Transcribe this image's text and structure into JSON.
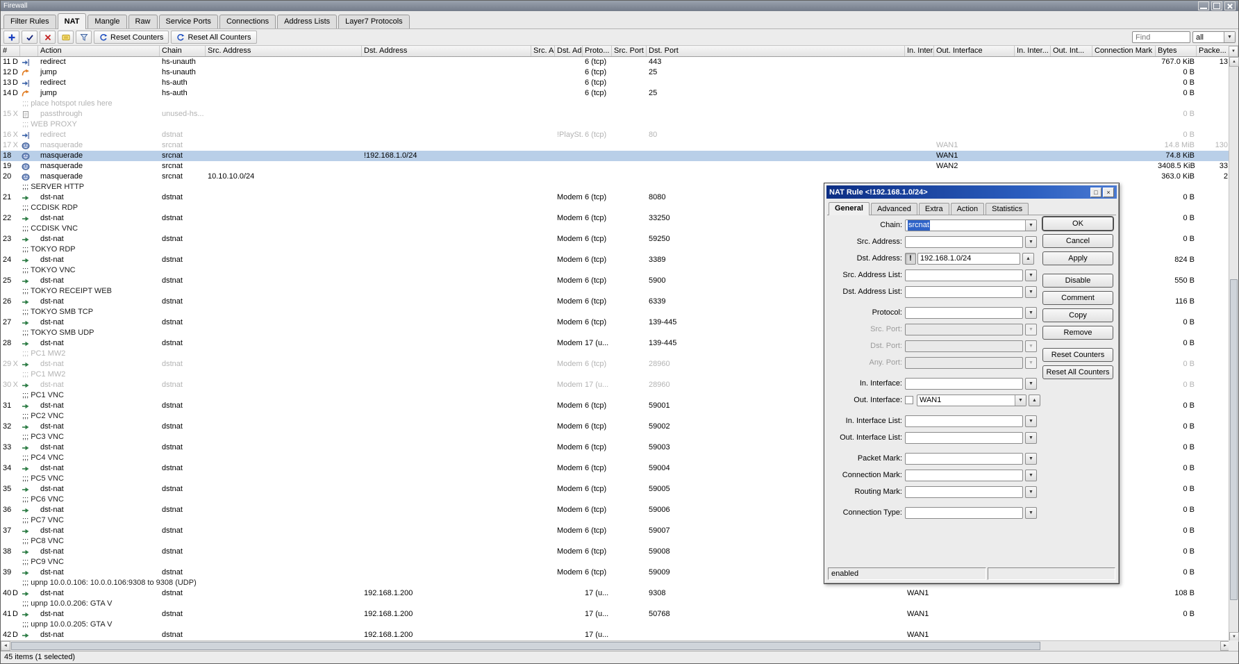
{
  "window": {
    "title": "Firewall"
  },
  "tabs": [
    "Filter Rules",
    "NAT",
    "Mangle",
    "Raw",
    "Service Ports",
    "Connections",
    "Address Lists",
    "Layer7 Protocols"
  ],
  "active_tab": "NAT",
  "toolbar": {
    "reset_counters_label": "Reset Counters",
    "reset_all_counters_label": "Reset All Counters",
    "find_placeholder": "Find",
    "filter_scope": "all"
  },
  "icons": {
    "up": "▲",
    "down": "▼",
    "left": "◄",
    "right": "►",
    "maximize": "□",
    "close": "×",
    "negate": "!"
  },
  "colors": {
    "dialog_titlebar": "#0c2e84",
    "selected_row": "#b9cfe8",
    "disabled_text": "#b3b3b3",
    "accent_blue": "#2f63c8"
  },
  "table": {
    "columns": [
      {
        "key": "num",
        "label": "#"
      },
      {
        "key": "icon",
        "label": ""
      },
      {
        "key": "action",
        "label": "Action"
      },
      {
        "key": "chain",
        "label": "Chain"
      },
      {
        "key": "srcAddress",
        "label": "Src. Address"
      },
      {
        "key": "dstAddress",
        "label": "Dst. Address"
      },
      {
        "key": "srcList",
        "label": "Src. Ad..."
      },
      {
        "key": "dstList",
        "label": "Dst. Ad..."
      },
      {
        "key": "protocol",
        "label": "Proto..."
      },
      {
        "key": "srcPort",
        "label": "Src. Port"
      },
      {
        "key": "dstPort",
        "label": "Dst. Port"
      },
      {
        "key": "inIface",
        "label": "In. Inter..."
      },
      {
        "key": "outIface",
        "label": "Out. Interface"
      },
      {
        "key": "inIfaceList",
        "label": "In. Inter..."
      },
      {
        "key": "outIfaceList",
        "label": "Out. Int..."
      },
      {
        "key": "connMark",
        "label": "Connection Mark"
      },
      {
        "key": "bytes",
        "label": "Bytes"
      },
      {
        "key": "packets",
        "label": "Packe..."
      }
    ],
    "rows": [
      {
        "num": "11",
        "flag": "D",
        "action": "redirect",
        "chain": "hs-unauth",
        "protocol": "6 (tcp)",
        "dstPort": "443",
        "bytes": "767.0 KiB",
        "packets": "13"
      },
      {
        "num": "12",
        "flag": "D",
        "action": "jump",
        "chain": "hs-unauth",
        "protocol": "6 (tcp)",
        "dstPort": "25",
        "bytes": "0 B"
      },
      {
        "num": "13",
        "flag": "D",
        "action": "redirect",
        "chain": "hs-auth",
        "protocol": "6 (tcp)",
        "bytes": "0 B"
      },
      {
        "num": "14",
        "flag": "D",
        "action": "jump",
        "chain": "hs-auth",
        "protocol": "6 (tcp)",
        "dstPort": "25",
        "bytes": "0 B"
      },
      {
        "comment": ";;; place hotspot rules here",
        "disabled": true
      },
      {
        "num": "15",
        "flag": "X",
        "action": "passthrough",
        "chain": "unused-hs...",
        "bytes": "0 B",
        "disabled": true
      },
      {
        "comment": ";;; WEB PROXY",
        "disabled": true
      },
      {
        "num": "16",
        "flag": "X",
        "action": "redirect",
        "chain": "dstnat",
        "dstList": "!PlaySt...",
        "protocol": "6 (tcp)",
        "dstPort": "80",
        "bytes": "0 B",
        "disabled": true
      },
      {
        "num": "17",
        "flag": "X",
        "action": "masquerade",
        "chain": "srcnat",
        "outIface": "WAN1",
        "bytes": "14.8 MiB",
        "packets": "130",
        "disabled": true
      },
      {
        "num": "18",
        "action": "masquerade",
        "chain": "srcnat",
        "dstAddress": "!192.168.1.0/24",
        "outIface": "WAN1",
        "bytes": "74.8 KiB",
        "selected": true
      },
      {
        "num": "19",
        "action": "masquerade",
        "chain": "srcnat",
        "outIface": "WAN2",
        "bytes": "3408.5 KiB",
        "packets": "33"
      },
      {
        "num": "20",
        "action": "masquerade",
        "chain": "srcnat",
        "srcAddress": "10.10.10.0/24",
        "bytes": "363.0 KiB",
        "packets": "2"
      },
      {
        "comment": ";;; SERVER HTTP"
      },
      {
        "num": "21",
        "action": "dst-nat",
        "chain": "dstnat",
        "dstList": "Modem...",
        "protocol": "6 (tcp)",
        "dstPort": "8080",
        "bytes": "0 B"
      },
      {
        "comment": ";;; CCDISK RDP"
      },
      {
        "num": "22",
        "action": "dst-nat",
        "chain": "dstnat",
        "dstList": "Modem...",
        "protocol": "6 (tcp)",
        "dstPort": "33250",
        "bytes": "0 B"
      },
      {
        "comment": ";;; CCDISK VNC"
      },
      {
        "num": "23",
        "action": "dst-nat",
        "chain": "dstnat",
        "dstList": "Modem...",
        "protocol": "6 (tcp)",
        "dstPort": "59250",
        "bytes": "0 B"
      },
      {
        "comment": ";;; TOKYO RDP"
      },
      {
        "num": "24",
        "action": "dst-nat",
        "chain": "dstnat",
        "dstList": "Modem...",
        "protocol": "6 (tcp)",
        "dstPort": "3389",
        "bytes": "824 B"
      },
      {
        "comment": ";;; TOKYO VNC"
      },
      {
        "num": "25",
        "action": "dst-nat",
        "chain": "dstnat",
        "dstList": "Modem...",
        "protocol": "6 (tcp)",
        "dstPort": "5900",
        "bytes": "550 B"
      },
      {
        "comment": ";;; TOKYO RECEIPT WEB"
      },
      {
        "num": "26",
        "action": "dst-nat",
        "chain": "dstnat",
        "dstList": "Modem...",
        "protocol": "6 (tcp)",
        "dstPort": "6339",
        "bytes": "116 B"
      },
      {
        "comment": ";;; TOKYO SMB TCP"
      },
      {
        "num": "27",
        "action": "dst-nat",
        "chain": "dstnat",
        "dstList": "Modem...",
        "protocol": "6 (tcp)",
        "dstPort": "139-445",
        "bytes": "0 B"
      },
      {
        "comment": ";;; TOKYO SMB UDP"
      },
      {
        "num": "28",
        "action": "dst-nat",
        "chain": "dstnat",
        "dstList": "Modem...",
        "protocol": "17 (u...",
        "dstPort": "139-445",
        "bytes": "0 B"
      },
      {
        "comment": ";;; PC1 MW2",
        "disabled": true
      },
      {
        "num": "29",
        "flag": "X",
        "action": "dst-nat",
        "chain": "dstnat",
        "dstList": "Modem...",
        "protocol": "6 (tcp)",
        "dstPort": "28960",
        "bytes": "0 B",
        "disabled": true
      },
      {
        "comment": ";;; PC1 MW2",
        "disabled": true
      },
      {
        "num": "30",
        "flag": "X",
        "action": "dst-nat",
        "chain": "dstnat",
        "dstList": "Modem...",
        "protocol": "17 (u...",
        "dstPort": "28960",
        "bytes": "0 B",
        "disabled": true
      },
      {
        "comment": ";;; PC1 VNC"
      },
      {
        "num": "31",
        "action": "dst-nat",
        "chain": "dstnat",
        "dstList": "Modem...",
        "protocol": "6 (tcp)",
        "dstPort": "59001",
        "bytes": "0 B"
      },
      {
        "comment": ";;; PC2 VNC"
      },
      {
        "num": "32",
        "action": "dst-nat",
        "chain": "dstnat",
        "dstList": "Modem...",
        "protocol": "6 (tcp)",
        "dstPort": "59002",
        "bytes": "0 B"
      },
      {
        "comment": ";;; PC3 VNC"
      },
      {
        "num": "33",
        "action": "dst-nat",
        "chain": "dstnat",
        "dstList": "Modem...",
        "protocol": "6 (tcp)",
        "dstPort": "59003",
        "bytes": "0 B"
      },
      {
        "comment": ";;; PC4 VNC"
      },
      {
        "num": "34",
        "action": "dst-nat",
        "chain": "dstnat",
        "dstList": "Modem...",
        "protocol": "6 (tcp)",
        "dstPort": "59004",
        "bytes": "0 B"
      },
      {
        "comment": ";;; PC5 VNC"
      },
      {
        "num": "35",
        "action": "dst-nat",
        "chain": "dstnat",
        "dstList": "Modem...",
        "protocol": "6 (tcp)",
        "dstPort": "59005",
        "bytes": "0 B"
      },
      {
        "comment": ";;; PC6 VNC"
      },
      {
        "num": "36",
        "action": "dst-nat",
        "chain": "dstnat",
        "dstList": "Modem...",
        "protocol": "6 (tcp)",
        "dstPort": "59006",
        "bytes": "0 B"
      },
      {
        "comment": ";;; PC7 VNC"
      },
      {
        "num": "37",
        "action": "dst-nat",
        "chain": "dstnat",
        "dstList": "Modem...",
        "protocol": "6 (tcp)",
        "dstPort": "59007",
        "bytes": "0 B"
      },
      {
        "comment": ";;; PC8 VNC"
      },
      {
        "num": "38",
        "action": "dst-nat",
        "chain": "dstnat",
        "dstList": "Modem...",
        "protocol": "6 (tcp)",
        "dstPort": "59008",
        "bytes": "0 B"
      },
      {
        "comment": ";;; PC9 VNC"
      },
      {
        "num": "39",
        "action": "dst-nat",
        "chain": "dstnat",
        "dstList": "Modem...",
        "protocol": "6 (tcp)",
        "dstPort": "59009",
        "bytes": "0 B"
      },
      {
        "comment": ";;; upnp 10.0.0.106: 10.0.0.106:9308 to 9308 (UDP)"
      },
      {
        "num": "40",
        "flag": "D",
        "action": "dst-nat",
        "chain": "dstnat",
        "dstAddress": "192.168.1.200",
        "protocol": "17 (u...",
        "dstPort": "9308",
        "inIface": "WAN1",
        "bytes": "108 B"
      },
      {
        "comment": ";;; upnp 10.0.0.206: GTA V"
      },
      {
        "num": "41",
        "flag": "D",
        "action": "dst-nat",
        "chain": "dstnat",
        "dstAddress": "192.168.1.200",
        "protocol": "17 (u...",
        "dstPort": "50768",
        "inIface": "WAN1",
        "bytes": "0 B"
      },
      {
        "comment": ";;; upnp 10.0.0.205: GTA V"
      },
      {
        "num": "42",
        "flag": "D",
        "action": "dst-nat",
        "chain": "dstnat",
        "dstAddress": "192.168.1.200",
        "protocol": "17 (u...",
        "inIface": "WAN1"
      }
    ]
  },
  "dialog": {
    "title": "NAT Rule <!192.168.1.0/24>",
    "tabs": [
      "General",
      "Advanced",
      "Extra",
      "Action",
      "Statistics"
    ],
    "active_tab": "General",
    "fields": [
      {
        "label": "Chain:",
        "value": "srcnat",
        "control": "combo",
        "text_selected": true
      },
      {
        "label": "Src. Address:",
        "value": "",
        "arrow": "down"
      },
      {
        "label": "Dst. Address:",
        "value": "192.168.1.0/24",
        "arrow": "up",
        "negate": true
      },
      {
        "label": "Src. Address List:",
        "value": "",
        "arrow": "down"
      },
      {
        "label": "Dst. Address List:",
        "value": "",
        "arrow": "down"
      },
      {
        "label": "Protocol:",
        "value": "",
        "arrow": "down",
        "gap": true
      },
      {
        "label": "Src. Port:",
        "value": "",
        "arrow": "down",
        "disabled": true
      },
      {
        "label": "Dst. Port:",
        "value": "",
        "arrow": "down",
        "disabled": true
      },
      {
        "label": "Any. Port:",
        "value": "",
        "arrow": "down",
        "disabled": true
      },
      {
        "label": "In. Interface:",
        "value": "",
        "arrow": "down",
        "gap": true
      },
      {
        "label": "Out. Interface:",
        "value": "WAN1",
        "control": "combo",
        "checkbox": true,
        "arrow": "up"
      },
      {
        "label": "In. Interface List:",
        "value": "",
        "arrow": "down",
        "gap": true
      },
      {
        "label": "Out. Interface List:",
        "value": "",
        "arrow": "down"
      },
      {
        "label": "Packet Mark:",
        "value": "",
        "arrow": "down",
        "gap": true
      },
      {
        "label": "Connection Mark:",
        "value": "",
        "arrow": "down"
      },
      {
        "label": "Routing Mark:",
        "value": "",
        "arrow": "down"
      },
      {
        "label": "Connection Type:",
        "value": "",
        "arrow": "down",
        "gap": true
      }
    ],
    "buttons": [
      {
        "label": "OK",
        "default": true
      },
      {
        "label": "Cancel"
      },
      {
        "label": "Apply"
      },
      {
        "label": "Disable",
        "gap": true
      },
      {
        "label": "Comment"
      },
      {
        "label": "Copy"
      },
      {
        "label": "Remove"
      },
      {
        "label": "Reset Counters",
        "gap": true
      },
      {
        "label": "Reset All Counters"
      }
    ],
    "status": "enabled"
  },
  "statusbar": {
    "text": "45 items (1 selected)"
  }
}
